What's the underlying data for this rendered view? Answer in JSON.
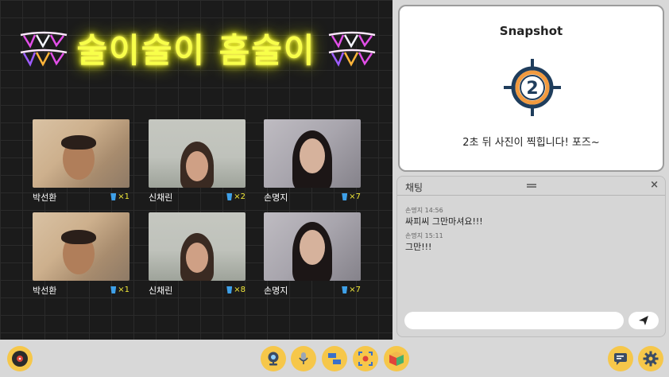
{
  "stage": {
    "title": "술이술이 홈술이",
    "tiles": [
      {
        "name": "박선환",
        "count": "×1"
      },
      {
        "name": "신채린",
        "count": "×2"
      },
      {
        "name": "손명지",
        "count": "×7"
      },
      {
        "name": "박선환",
        "count": "×1"
      },
      {
        "name": "신채린",
        "count": "×8"
      },
      {
        "name": "손명지",
        "count": "×7"
      }
    ]
  },
  "snapshot": {
    "title": "Snapshot",
    "countdown": "2",
    "message": "2초 뒤 사진이 찍힙니다! 포즈~"
  },
  "chat": {
    "title": "채팅",
    "close_label": "×",
    "messages": [
      {
        "meta": "손명지 14:56",
        "text": "싸피씨 그만마셔요!!!"
      },
      {
        "meta": "손명지 15:11",
        "text": "그만!!!"
      }
    ],
    "input_value": "",
    "input_placeholder": ""
  },
  "toolbar": {
    "icons": [
      "vinyl-record-icon",
      "webcam-icon",
      "microphone-icon",
      "screen-share-icon",
      "snapshot-icon",
      "game-cube-icon",
      "chat-bubble-icon",
      "settings-gear-icon"
    ]
  },
  "colors": {
    "neon": "#f8ff4a",
    "brick": "#1b1b1b",
    "accent": "#f6c74a",
    "badge_orange": "#f29a3e",
    "badge_blue": "#1f3d5c"
  }
}
